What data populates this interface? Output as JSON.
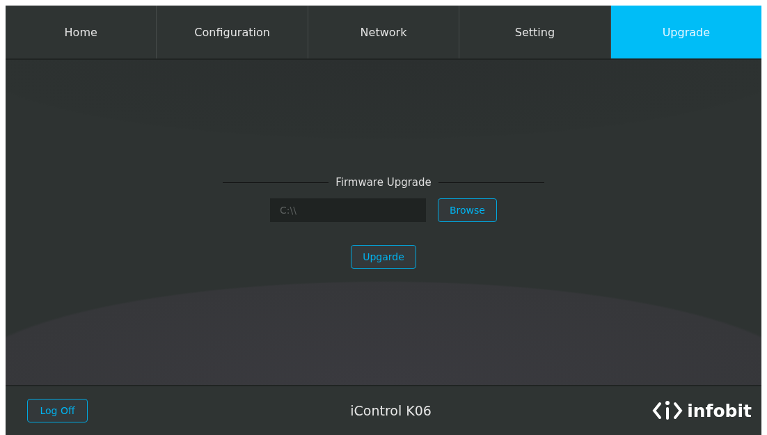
{
  "tabs": [
    {
      "label": "Home",
      "selected": false
    },
    {
      "label": "Configuration",
      "selected": false
    },
    {
      "label": "Network",
      "selected": false
    },
    {
      "label": "Setting",
      "selected": false
    },
    {
      "label": "Upgrade",
      "selected": true
    }
  ],
  "firmware": {
    "title": "Firmware Upgrade",
    "path": "C:\\\\",
    "browse": "Browse",
    "upgrade": "Upgarde"
  },
  "footer": {
    "logoff": "Log Off",
    "device": "iControl K06",
    "brand": "infobit"
  }
}
